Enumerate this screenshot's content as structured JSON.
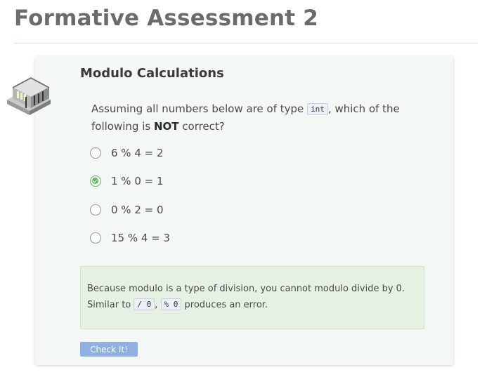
{
  "page": {
    "title": "Formative Assessment 2"
  },
  "card": {
    "icon": "building-icon",
    "title": "Modulo Calculations",
    "question": {
      "before": "Assuming all numbers below are of type ",
      "code": "int",
      "middle": ", which of the following is ",
      "bold": "NOT",
      "after": " correct?"
    },
    "options": [
      {
        "label": "6 % 4 = 2",
        "selected": false
      },
      {
        "label": "1 % 0 = 1",
        "selected": true
      },
      {
        "label": "0 % 2 = 0",
        "selected": false
      },
      {
        "label": "15 % 4 = 3",
        "selected": false
      }
    ],
    "feedback": {
      "line1": "Because modulo is a type of division, you cannot modulo divide by 0.",
      "before": "Similar to ",
      "code1": "/ 0",
      "sep": ", ",
      "code2": "% 0",
      "after": " produces an error."
    },
    "check_button": "Check It!"
  },
  "colors": {
    "accent_selected": "#5cb85c",
    "button": "#8fb0e2",
    "card_background": "#f3f8f4",
    "feedback_background": "#e6f1e4"
  }
}
